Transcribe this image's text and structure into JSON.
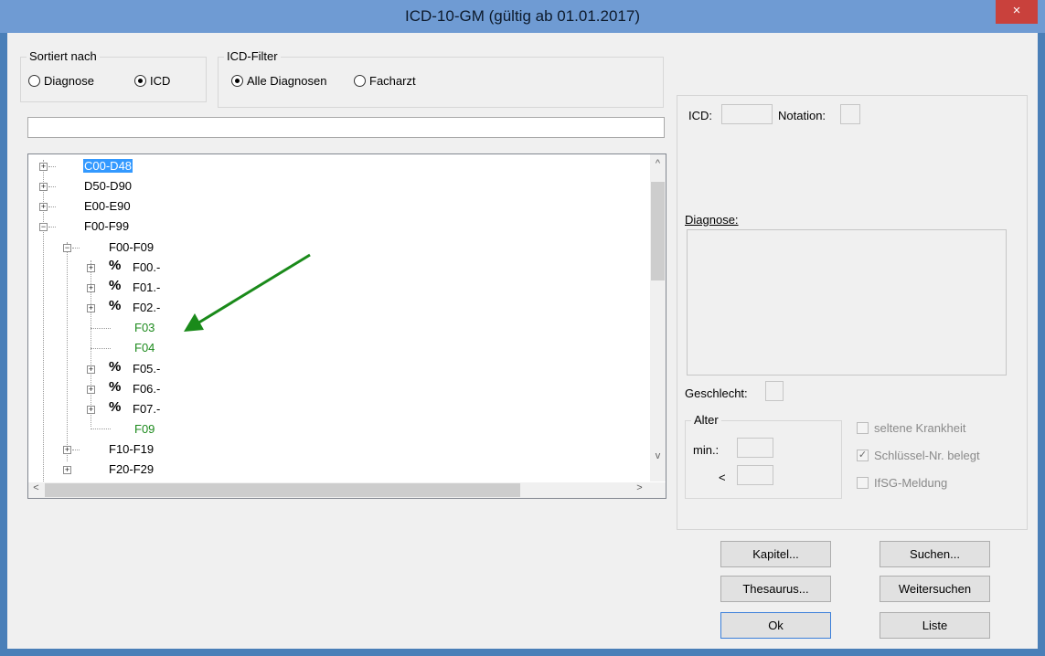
{
  "window": {
    "title": "ICD-10-GM (gültig ab 01.01.2017)",
    "close_glyph": "×"
  },
  "sort_group": {
    "legend": "Sortiert nach",
    "options": [
      {
        "label": "Diagnose",
        "selected": false
      },
      {
        "label": "ICD",
        "selected": true
      }
    ]
  },
  "filter_group": {
    "legend": "ICD-Filter",
    "options": [
      {
        "label": "Alle Diagnosen",
        "selected": true
      },
      {
        "label": "Facharzt",
        "selected": false
      }
    ]
  },
  "search": {
    "value": ""
  },
  "tree": {
    "items": [
      {
        "label": "C00-D48",
        "selected": true
      },
      {
        "label": "D50-D90"
      },
      {
        "label": "E00-E90"
      },
      {
        "label": "F00-F99"
      },
      {
        "label": "F00-F09"
      },
      {
        "label": "F00.-",
        "percent": "%"
      },
      {
        "label": "F01.-",
        "percent": "%"
      },
      {
        "label": "F02.-",
        "percent": "%"
      },
      {
        "label": "F03",
        "color": "green"
      },
      {
        "label": "F04",
        "color": "green"
      },
      {
        "label": "F05.-",
        "percent": "%"
      },
      {
        "label": "F06.-",
        "percent": "%"
      },
      {
        "label": "F07.-",
        "percent": "%"
      },
      {
        "label": "F09",
        "color": "green"
      },
      {
        "label": "F10-F19"
      },
      {
        "label": "F20-F29"
      }
    ],
    "expander_plus": "+",
    "expander_minus": "−",
    "scroll_up": "^",
    "scroll_down": "v",
    "scroll_left": "<",
    "scroll_right": ">"
  },
  "details": {
    "icd_label": "ICD:",
    "icd_value": "",
    "notation_label": "Notation:",
    "notation_value": "",
    "diagnose_label": "Diagnose:",
    "diagnose_value": "",
    "geschlecht_label": "Geschlecht:",
    "alter_legend": "Alter",
    "min_label": "min.:",
    "lt_label": "<",
    "checkboxes": [
      {
        "label": "seltene Krankheit",
        "checked": false
      },
      {
        "label": "Schlüssel-Nr. belegt",
        "checked": true
      },
      {
        "label": "IfSG-Meldung",
        "checked": false
      }
    ],
    "check_glyph": "✓"
  },
  "buttons": {
    "kapitel": "Kapitel...",
    "suchen": "Suchen...",
    "thesaurus": "Thesaurus...",
    "weitersuchen": "Weitersuchen",
    "ok": "Ok",
    "liste": "Liste"
  },
  "annotation": {
    "color": "#1a8a1a",
    "points_to": "F03"
  },
  "colors": {
    "title_bar": "#6f9bd3",
    "close": "#c9413c",
    "selected_bg": "#3399ff",
    "green_text": "#1d8a1d"
  }
}
